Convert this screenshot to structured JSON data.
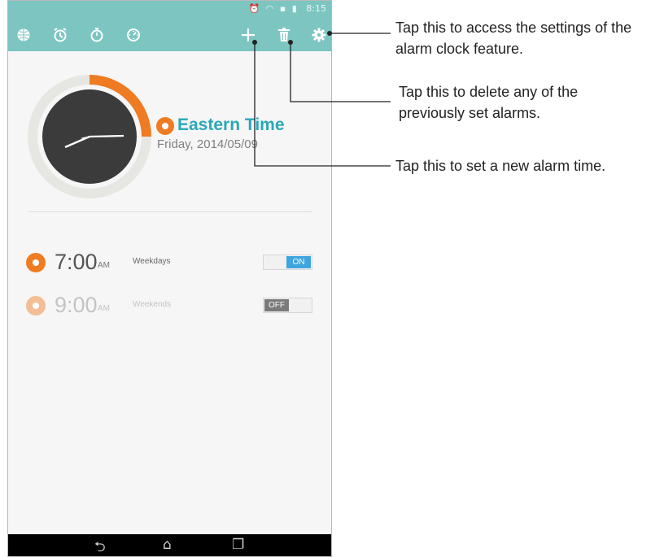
{
  "status_bar": {
    "icons": [
      "alarm-status-icon",
      "wifi-icon",
      "notification-icon",
      "battery-icon"
    ],
    "time": "8:15"
  },
  "action_bar": {
    "tabs": [
      "world-clock-icon",
      "alarm-clock-icon",
      "stopwatch-icon",
      "timer-icon"
    ],
    "actions": [
      "add-icon",
      "delete-icon",
      "settings-icon"
    ]
  },
  "clock": {
    "timezone": "Eastern Time",
    "date": "Friday, 2014/05/09"
  },
  "alarms": [
    {
      "time": "7:00",
      "ampm": "AM",
      "label": "Weekdays",
      "toggle": "ON",
      "enabled": true
    },
    {
      "time": "9:00",
      "ampm": "AM",
      "label": "Weekends",
      "toggle": "OFF",
      "enabled": false
    }
  ],
  "callouts": {
    "settings_line1": "Tap this to access the settings of the",
    "settings_line2": "alarm clock feature.",
    "delete_line1": "Tap this to delete any of the",
    "delete_line2": "previously set alarms.",
    "add": "Tap this to set a new alarm time."
  },
  "colors": {
    "accent_teal": "#7cc5c1",
    "timezone_text": "#2aa8b8",
    "orange": "#ef7b22",
    "toggle_on": "#3fa5df",
    "toggle_off": "#7a7a7a"
  }
}
